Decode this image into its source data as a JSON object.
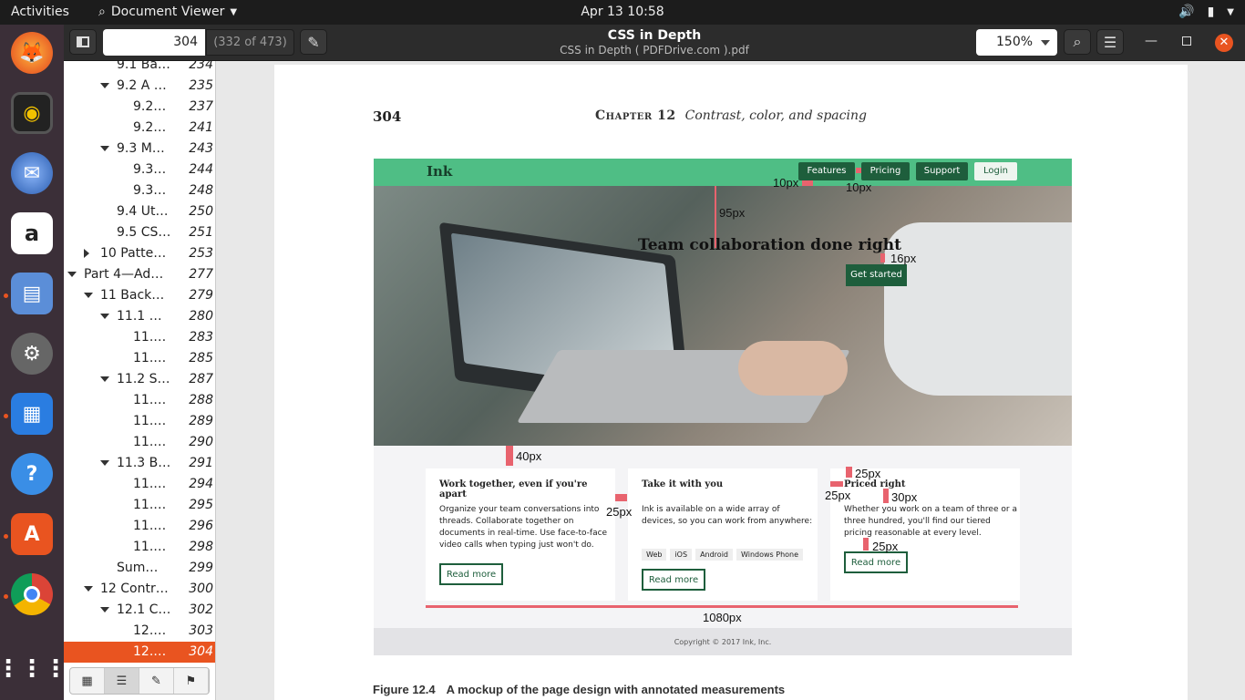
{
  "topbar": {
    "activities": "Activities",
    "app_name": "Document Viewer",
    "clock": "Apr 13  10:58"
  },
  "dock": {
    "items": [
      "firefox-icon",
      "rhythmbox-icon",
      "thunderbird-icon",
      "amazon-icon",
      "files-icon",
      "settings-icon",
      "writer-icon",
      "help-icon",
      "software-icon",
      "chrome-icon",
      "apps-grid-icon"
    ]
  },
  "header": {
    "page_input": "304",
    "page_count": "(332 of 473)",
    "title": "CSS in Depth",
    "subtitle": "CSS in Depth ( PDFDrive.com ).pdf",
    "zoom": "150%"
  },
  "toc": [
    {
      "label": "9.1 Ba…",
      "page": "234"
    },
    {
      "label": "9.2 A …",
      "page": "235"
    },
    {
      "label": "9.2…",
      "page": "237"
    },
    {
      "label": "9.2…",
      "page": "241"
    },
    {
      "label": "9.3 M…",
      "page": "243"
    },
    {
      "label": "9.3…",
      "page": "244"
    },
    {
      "label": "9.3…",
      "page": "248"
    },
    {
      "label": "9.4 Ut…",
      "page": "250"
    },
    {
      "label": "9.5 CS…",
      "page": "251"
    },
    {
      "label": "10 Patte…",
      "page": "253"
    },
    {
      "label": "Part 4—Ad…",
      "page": "277"
    },
    {
      "label": "11 Back…",
      "page": "279"
    },
    {
      "label": "11.1 …",
      "page": "280"
    },
    {
      "label": "11.…",
      "page": "283"
    },
    {
      "label": "11.…",
      "page": "285"
    },
    {
      "label": "11.2 S…",
      "page": "287"
    },
    {
      "label": "11.…",
      "page": "288"
    },
    {
      "label": "11.…",
      "page": "289"
    },
    {
      "label": "11.…",
      "page": "290"
    },
    {
      "label": "11.3 B…",
      "page": "291"
    },
    {
      "label": "11.…",
      "page": "294"
    },
    {
      "label": "11.…",
      "page": "295"
    },
    {
      "label": "11.…",
      "page": "296"
    },
    {
      "label": "11.…",
      "page": "298"
    },
    {
      "label": "Sum…",
      "page": "299"
    },
    {
      "label": "12 Contr…",
      "page": "300"
    },
    {
      "label": "12.1 C…",
      "page": "302"
    },
    {
      "label": "12.…",
      "page": "303"
    },
    {
      "label": "12.…",
      "page": "304"
    }
  ],
  "pdf": {
    "page_number": "304",
    "chapter_label": "Chapter 12",
    "chapter_title": "Contrast, color, and spacing",
    "mockup": {
      "logo": "Ink",
      "nav": [
        "Features",
        "Pricing",
        "Support",
        "Login"
      ],
      "hero_title": "Team collaboration done right",
      "cta": "Get started",
      "cards": [
        {
          "title": "Work together, even if you're apart",
          "text": "Organize your team conversations into threads. Collaborate together on documents in real-time. Use face-to-face video calls when typing just won't do.",
          "button": "Read more"
        },
        {
          "title": "Take it with you",
          "text": "Ink is available on a wide array of devices, so you can work from anywhere:",
          "tags": [
            "Web",
            "iOS",
            "Android",
            "Windows Phone"
          ],
          "button": "Read more"
        },
        {
          "title": "Priced right",
          "text": "Whether you work on a team of three or a three hundred, you'll find our tiered pricing reasonable at every level.",
          "button": "Read more"
        }
      ],
      "footer": "Copyright © 2017 Ink, Inc.",
      "annotations": {
        "a10a": "10px",
        "a10b": "10px",
        "a95": "95px",
        "a16": "16px",
        "a40": "40px",
        "a25a": "25px",
        "a25b": "25px",
        "a25c": "25px",
        "a30": "30px",
        "a25d": "25px",
        "a1080": "1080px"
      }
    },
    "caption_label": "Figure 12.4",
    "caption_text": "A mockup of the page design with annotated measurements"
  },
  "colors": {
    "accent": "#e95420",
    "brand_green": "#4fbe85",
    "dark_green": "#1e5e3c",
    "annotation_red": "#e8636e"
  }
}
